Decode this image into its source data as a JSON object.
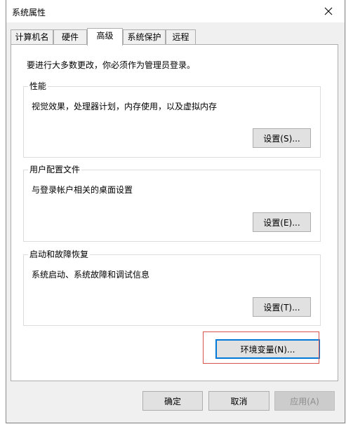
{
  "window": {
    "title": "系统属性"
  },
  "tabs": [
    {
      "label": "计算机名",
      "active": false
    },
    {
      "label": "硬件",
      "active": false
    },
    {
      "label": "高级",
      "active": true
    },
    {
      "label": "系统保护",
      "active": false
    },
    {
      "label": "远程",
      "active": false
    }
  ],
  "advanced": {
    "admin_notice": "要进行大多数更改，你必须作为管理员登录。",
    "performance": {
      "title": "性能",
      "description": "视觉效果，处理器计划，内存使用，以及虚拟内存",
      "button": "设置(S)..."
    },
    "user_profiles": {
      "title": "用户配置文件",
      "description": "与登录帐户相关的桌面设置",
      "button": "设置(E)..."
    },
    "startup_recovery": {
      "title": "启动和故障恢复",
      "description": "系统启动、系统故障和调试信息",
      "button": "设置(T)..."
    },
    "env_button": "环境变量(N)..."
  },
  "footer": {
    "ok": "确定",
    "cancel": "取消",
    "apply": "应用(A)"
  },
  "colors": {
    "accent": "#0078d7",
    "highlight_box": "#d9534f"
  },
  "icons": {
    "close": "close-icon"
  }
}
